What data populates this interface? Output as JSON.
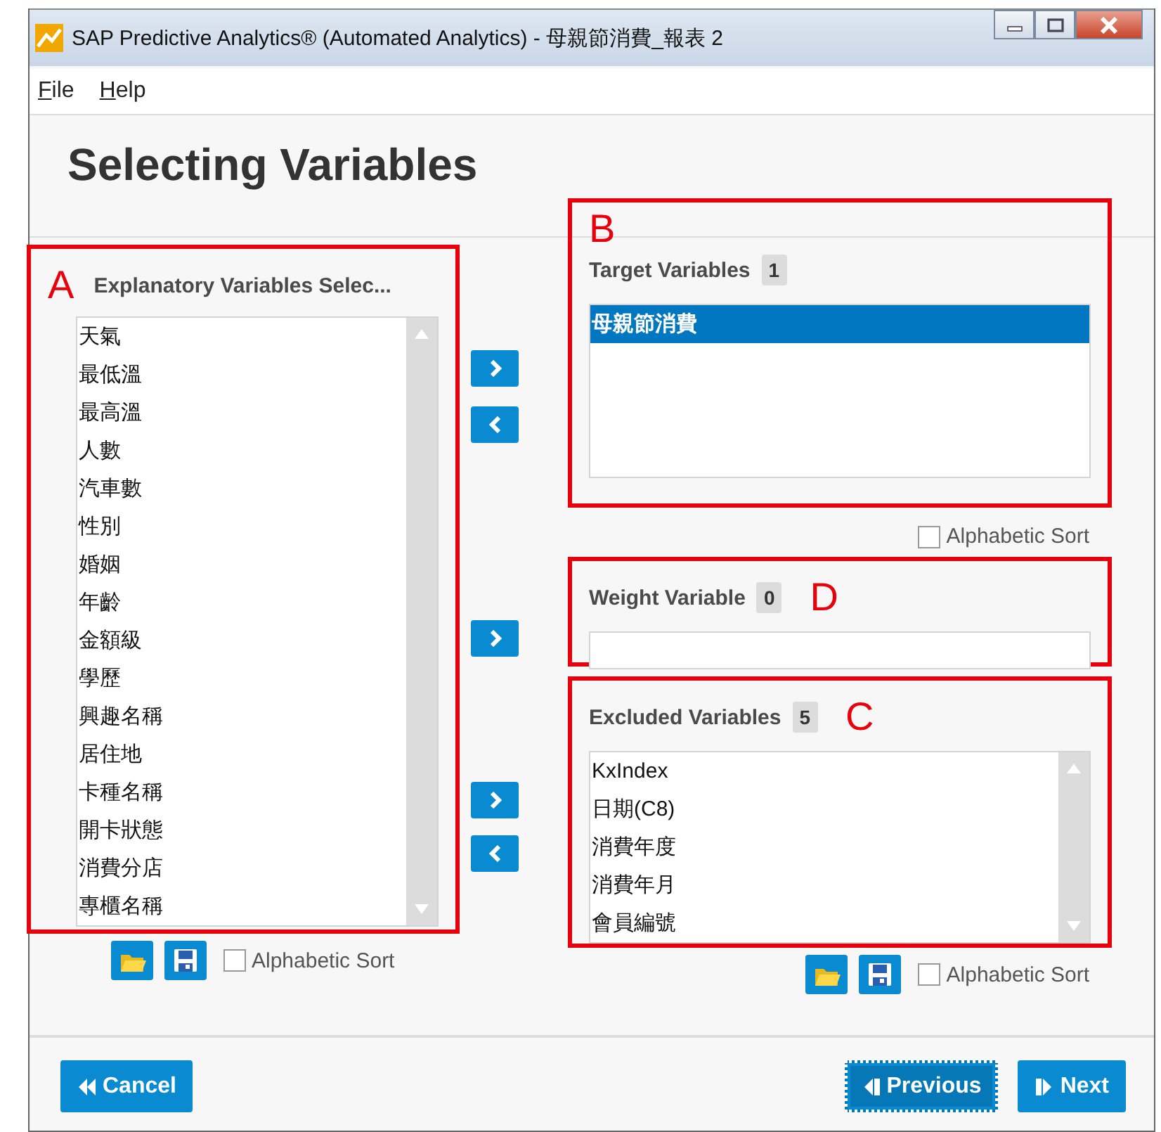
{
  "window": {
    "title": "SAP Predictive Analytics® (Automated Analytics) - 母親節消費_報表 2"
  },
  "menu": [
    {
      "label": "File"
    },
    {
      "label": "Help"
    }
  ],
  "heading": "Selecting Variables",
  "explanatory": {
    "marker": "A",
    "title": "Explanatory Variables Selec...",
    "items": [
      {
        "label": "天氣",
        "selected": false
      },
      {
        "label": "最低溫",
        "selected": false
      },
      {
        "label": "最高溫",
        "selected": false
      },
      {
        "label": "人數",
        "selected": false
      },
      {
        "label": "汽車數",
        "selected": false
      },
      {
        "label": "性別",
        "selected": false
      },
      {
        "label": "婚姻",
        "selected": false
      },
      {
        "label": "年齡",
        "selected": false
      },
      {
        "label": "金額級",
        "selected": false
      },
      {
        "label": "學歷",
        "selected": false
      },
      {
        "label": "興趣名稱",
        "selected": false
      },
      {
        "label": "居住地",
        "selected": false
      },
      {
        "label": "卡種名稱",
        "selected": false
      },
      {
        "label": "開卡狀態",
        "selected": false
      },
      {
        "label": "消費分店",
        "selected": false
      },
      {
        "label": "專櫃名稱",
        "selected": false
      }
    ],
    "alphabetic_sort": {
      "label": "Alphabetic Sort",
      "checked": false
    }
  },
  "target": {
    "marker": "B",
    "title": "Target Variables",
    "count": "1",
    "items": [
      {
        "label": "母親節消費",
        "selected": true
      }
    ],
    "alphabetic_sort": {
      "label": "Alphabetic Sort",
      "checked": false
    }
  },
  "weight": {
    "marker": "D",
    "title": "Weight Variable",
    "count": "0"
  },
  "excluded": {
    "marker": "C",
    "title": "Excluded Variables",
    "count": "5",
    "items": [
      {
        "label": "KxIndex",
        "selected": false
      },
      {
        "label": "日期(C8)",
        "selected": false
      },
      {
        "label": "消費年度",
        "selected": false
      },
      {
        "label": "消費年月",
        "selected": false
      },
      {
        "label": "會員編號",
        "selected": false
      }
    ],
    "alphabetic_sort": {
      "label": "Alphabetic Sort",
      "checked": false
    }
  },
  "buttons": [
    {
      "label": "Cancel",
      "kind": "cancel",
      "focused": false
    },
    {
      "label": "Previous",
      "kind": "previous",
      "focused": true
    },
    {
      "label": "Next",
      "kind": "next",
      "focused": false
    }
  ]
}
